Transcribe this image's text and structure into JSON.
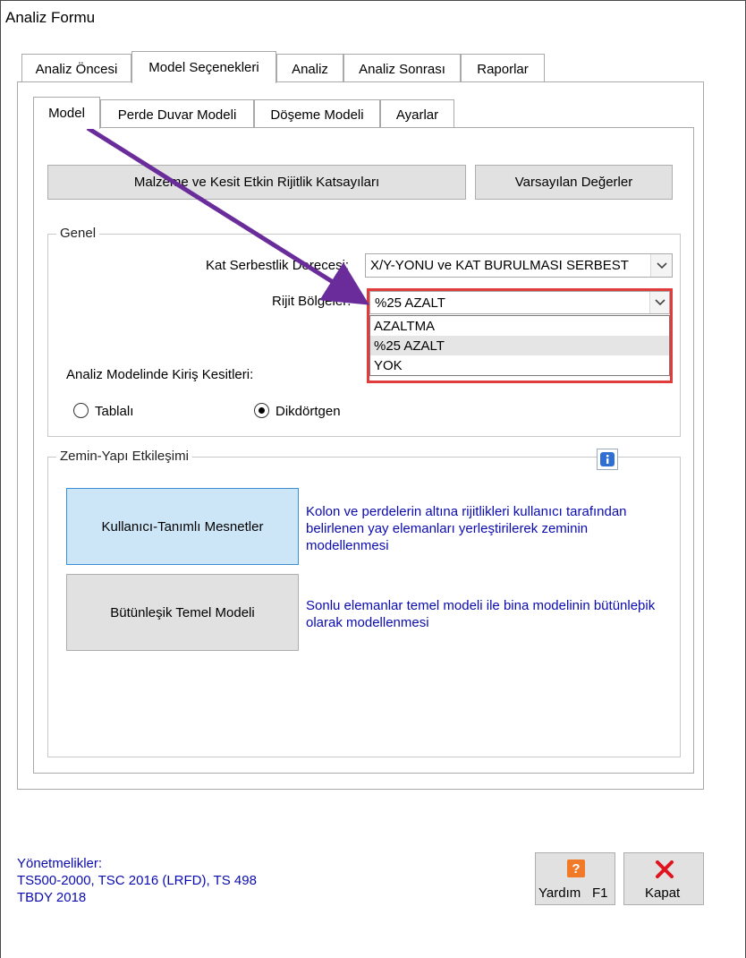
{
  "window": {
    "title": "Analiz Formu"
  },
  "main_tabs": [
    {
      "label": "Analiz Öncesi"
    },
    {
      "label": "Model Seçenekleri"
    },
    {
      "label": "Analiz"
    },
    {
      "label": "Analiz Sonrası"
    },
    {
      "label": "Raporlar"
    }
  ],
  "sub_tabs": [
    {
      "label": "Model"
    },
    {
      "label": "Perde Duvar Modeli"
    },
    {
      "label": "Döşeme Modeli"
    },
    {
      "label": "Ayarlar"
    }
  ],
  "toolbar": {
    "material_button": "Malzeme ve Kesit Etkin Rijitlik Katsayıları",
    "defaults_button": "Varsayılan Değerler"
  },
  "genel": {
    "title": "Genel",
    "dof_label": "Kat Serbestlik Derecesi:",
    "dof_value": "X/Y-YONU ve KAT BURULMASI SERBEST",
    "rigid_label": "Rijit Bölgeler:",
    "rigid_value": "%25 AZALT",
    "rigid_options": [
      "AZALTMA",
      "%25 AZALT",
      "YOK"
    ],
    "beam_label": "Analiz Modelinde Kiriş Kesitleri:",
    "radio_tablali": "Tablalı",
    "radio_dikdortgen": "Dikdörtgen"
  },
  "zemin": {
    "title": "Zemin-Yapı Etkileşimi",
    "info_icon": "info-icon",
    "user_supports_button": "Kullanıcı-Tanımlı Mesnetler",
    "user_supports_desc": "Kolon ve perdelerin altına rijitlikleri kullanıcı tarafından belirlenen yay elemanları yerleştirilerek zeminin modellenmesi",
    "integrated_button": "Bütünleşik Temel Modeli",
    "integrated_desc": "Sonlu elemanlar temel modeli ile bina modelinin bütünleþik olarak modellenmesi"
  },
  "footer": {
    "line1": "Yönetmelikler:",
    "line2": "TS500-2000,  TSC 2016 (LRFD),  TS 498",
    "line3": "TBDY 2018",
    "help_label": "Yardım",
    "help_key": "F1",
    "close_label": "Kapat"
  },
  "colors": {
    "annotation_red": "#e03c3c",
    "arrow_purple": "#6a2c9a",
    "link_blue": "#0b0bb0"
  }
}
